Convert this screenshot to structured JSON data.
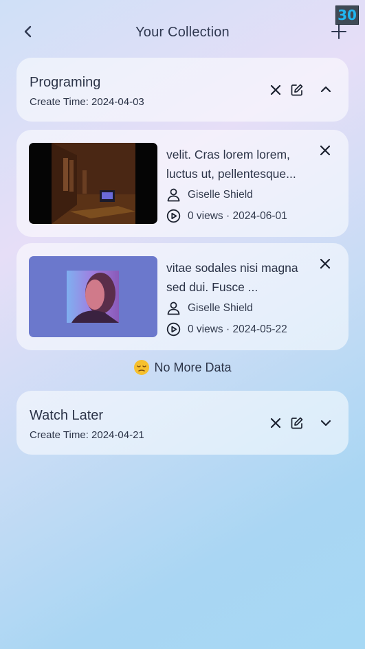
{
  "header": {
    "title": "Your Collection",
    "back_icon": "chevron-left-icon",
    "add_icon": "plus-icon",
    "fps_counter": "30"
  },
  "collections": [
    {
      "name": "Programing",
      "create_time": "Create Time: 2024-04-03",
      "expanded": true,
      "videos": [
        {
          "title": "velit. Cras lorem lorem, luctus ut, pellentesque...",
          "author": "Giselle Shield",
          "stats": "0 views · 2024-06-01"
        },
        {
          "title": "vitae sodales nisi magna sed dui. Fusce ...",
          "author": "Giselle Shield",
          "stats": "0 views · 2024-05-22"
        }
      ],
      "footer": "No More Data"
    },
    {
      "name": "Watch Later",
      "create_time": "Create Time: 2024-04-21",
      "expanded": false
    }
  ],
  "colors": {
    "text": "#2c3448",
    "card_bg": "rgba(255,255,255,0.55)",
    "fps_text": "#21b6f0"
  }
}
